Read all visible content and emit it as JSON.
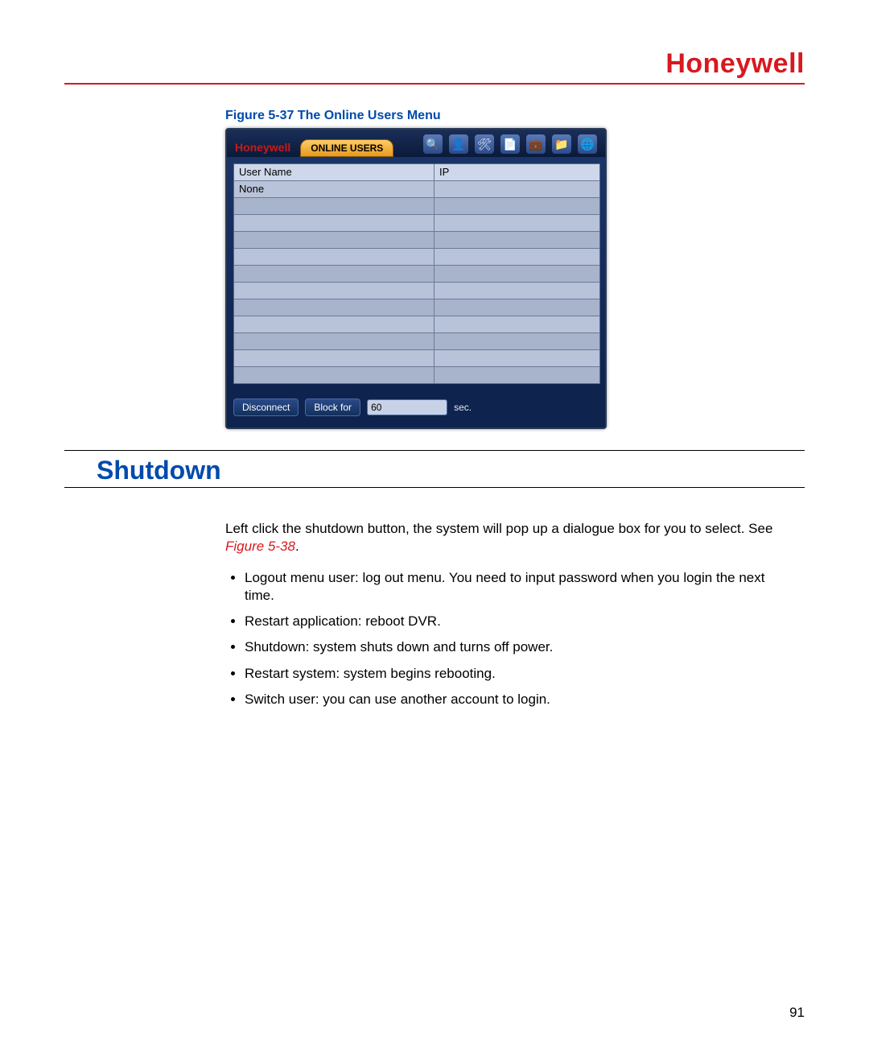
{
  "header": {
    "brand": "Honeywell"
  },
  "figure": {
    "caption": "Figure 5-37 The Online Users Menu",
    "dvr": {
      "logo": "Honeywell",
      "tab": "ONLINE USERS",
      "toolbar_icons": [
        "search-icon",
        "user-icon",
        "tools-icon",
        "paper-icon",
        "briefcase-icon",
        "folder-icon",
        "globe-icon"
      ],
      "columns": {
        "user": "User Name",
        "ip": "IP"
      },
      "rows": [
        {
          "user": "None",
          "ip": ""
        }
      ],
      "empty_row_count": 11,
      "buttons": {
        "disconnect": "Disconnect",
        "block": "Block for"
      },
      "block_value": "60",
      "block_unit": "sec."
    }
  },
  "section": {
    "title": "Shutdown"
  },
  "body": {
    "intro_a": "Left click the shutdown button, the system will pop up a dialogue box for you to select. See ",
    "intro_figref": "Figure 5-38",
    "intro_b": ".",
    "items": [
      "Logout menu user: log out menu. You need to input password when you login the next time.",
      "Restart application: reboot DVR.",
      "Shutdown: system shuts down and turns off power.",
      "Restart system: system begins rebooting.",
      "Switch user: you can use another account to login."
    ]
  },
  "page_number": "91"
}
